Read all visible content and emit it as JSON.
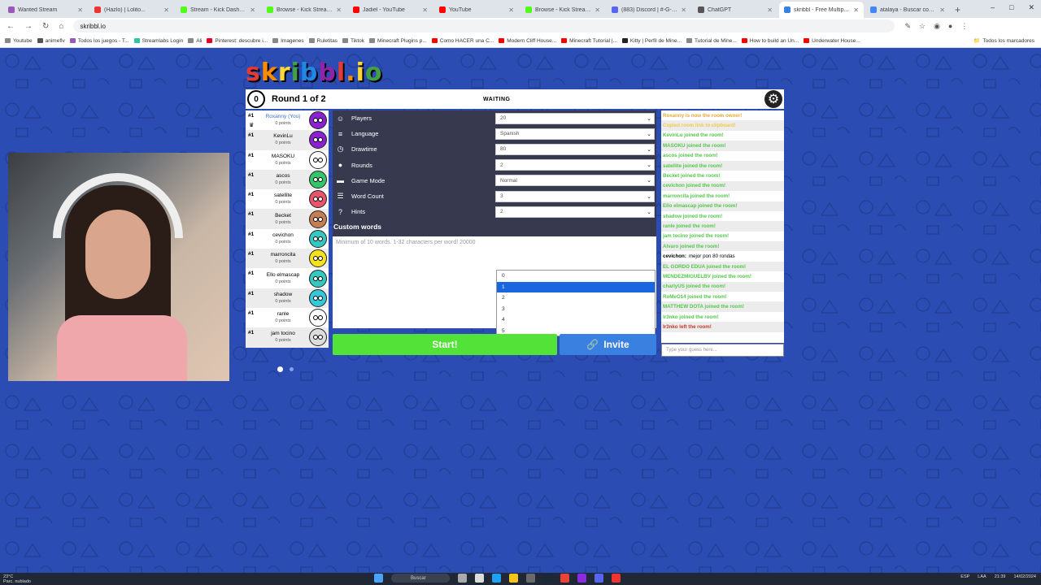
{
  "browser": {
    "tabs": [
      {
        "label": "Wanted Stream",
        "color": "#9b59b6"
      },
      {
        "label": "(Hazlo) | Lolito...",
        "color": "#e33"
      },
      {
        "label": "Stream - Kick Dashboard",
        "color": "#53fc18"
      },
      {
        "label": "Browse - Kick Streaming",
        "color": "#53fc18"
      },
      {
        "label": "Jadiel - YouTube",
        "color": "#f00"
      },
      {
        "label": "YouTube",
        "color": "#f00"
      },
      {
        "label": "Browse - Kick Streaming",
        "color": "#53fc18"
      },
      {
        "label": "(883) Discord | #-G-I-...",
        "color": "#5865f2"
      },
      {
        "label": "ChatGPT",
        "color": "#555"
      },
      {
        "label": "skribbl - Free Multip...",
        "color": "#3a80e0"
      },
      {
        "label": "atalaya - Buscar con Go...",
        "color": "#4285f4"
      }
    ],
    "active_tab": 9,
    "new_tab": "+",
    "window_controls": [
      "–",
      "□",
      "✕"
    ],
    "url": "skribbl.io",
    "bookmarks": [
      {
        "label": "Youtube",
        "color": "#888"
      },
      {
        "label": "animeflv",
        "color": "#555"
      },
      {
        "label": "Todos los juegos - T...",
        "color": "#9b59b6"
      },
      {
        "label": "Streamlabs Login",
        "color": "#31c3a2"
      },
      {
        "label": "Ali",
        "color": "#888"
      },
      {
        "label": "Pinterest: descubre i...",
        "color": "#e60023"
      },
      {
        "label": "Imagenes",
        "color": "#888"
      },
      {
        "label": "Ruletitas",
        "color": "#888"
      },
      {
        "label": "Tiktok",
        "color": "#888"
      },
      {
        "label": "Minecraft Plugins p...",
        "color": "#888"
      },
      {
        "label": "Como HACER una C...",
        "color": "#f00"
      },
      {
        "label": "Modern Cliff House...",
        "color": "#f00"
      },
      {
        "label": "Minecraft Tutorial |...",
        "color": "#f00"
      },
      {
        "label": "Kitty | Perfil de Mine...",
        "color": "#222"
      },
      {
        "label": "Tutorial de Mine...",
        "color": "#888"
      },
      {
        "label": "How to build an Un...",
        "color": "#f00"
      },
      {
        "label": "Underwater House...",
        "color": "#f00"
      }
    ],
    "bookmarks_all": "Todos los marcadores"
  },
  "game": {
    "logo": "skribbl.io",
    "clock": "0",
    "round": "Round 1 of 2",
    "status": "WAITING",
    "players": [
      {
        "rank": "#1",
        "name": "Roxanny (You)",
        "points": "0 points",
        "color": "#8b1fd1",
        "you": true
      },
      {
        "rank": "#1",
        "name": "KevinLu",
        "points": "0 points",
        "color": "#8b1fd1",
        "you": false
      },
      {
        "rank": "#1",
        "name": "MASOKU",
        "points": "0 points",
        "color": "#ffffff",
        "you": false
      },
      {
        "rank": "#1",
        "name": "ascos",
        "points": "0 points",
        "color": "#34c46a",
        "you": false
      },
      {
        "rank": "#1",
        "name": "satellite",
        "points": "0 points",
        "color": "#e9546b",
        "you": false
      },
      {
        "rank": "#1",
        "name": "Becket",
        "points": "0 points",
        "color": "#c57d54",
        "you": false
      },
      {
        "rank": "#1",
        "name": "cevichon",
        "points": "0 points",
        "color": "#35c8c0",
        "you": false
      },
      {
        "rank": "#1",
        "name": "marroncita",
        "points": "0 points",
        "color": "#f6e21a",
        "you": false
      },
      {
        "rank": "#1",
        "name": "Ello elmascap",
        "points": "0 points",
        "color": "#35c8c0",
        "you": false
      },
      {
        "rank": "#1",
        "name": "shadow",
        "points": "0 points",
        "color": "#35c8d8",
        "you": false
      },
      {
        "rank": "#1",
        "name": "ranle",
        "points": "0 points",
        "color": "#ffffff",
        "you": false
      },
      {
        "rank": "#1",
        "name": "jam tocino",
        "points": "0 points",
        "color": "#dddddd",
        "you": false
      }
    ],
    "settings": [
      {
        "label": "Players",
        "value": "20",
        "icon": "☺"
      },
      {
        "label": "Language",
        "value": "Spanish",
        "icon": "≡"
      },
      {
        "label": "Drawtime",
        "value": "80",
        "icon": "◷"
      },
      {
        "label": "Rounds",
        "value": "2",
        "icon": "●"
      },
      {
        "label": "Game Mode",
        "value": "Normal",
        "icon": "▬"
      },
      {
        "label": "Word Count",
        "value": "3",
        "icon": "☰"
      },
      {
        "label": "Hints",
        "value": "2",
        "icon": "?"
      }
    ],
    "custom_words_label": "Custom words",
    "custom_words_placeholder": "Minimum of 10 words. 1-32 characters per word! 20000",
    "hints_options": [
      "0",
      "1",
      "2",
      "3",
      "4",
      "5"
    ],
    "hints_highlighted": "1",
    "start_label": "Start!",
    "invite_label": "Invite",
    "chat": [
      {
        "text": "Roxanny is now the room owner!",
        "color": "#e8a83a"
      },
      {
        "text": "Copied room link to clipboard!",
        "color": "#f2c94c"
      },
      {
        "text": "KevinLu joined the room!",
        "color": "#53c84a"
      },
      {
        "text": "MASOKU joined the room!",
        "color": "#53c84a"
      },
      {
        "text": "ascos joined the room!",
        "color": "#53c84a"
      },
      {
        "text": "satellite joined the room!",
        "color": "#53c84a"
      },
      {
        "text": "Becket joined the room!",
        "color": "#53c84a"
      },
      {
        "text": "cevichon joined the room!",
        "color": "#53c84a"
      },
      {
        "text": "marroncita joined the room!",
        "color": "#53c84a"
      },
      {
        "text": "Ello elmascap joined the room!",
        "color": "#53c84a"
      },
      {
        "text": "shadow joined the room!",
        "color": "#53c84a"
      },
      {
        "text": "ranle joined the room!",
        "color": "#53c84a"
      },
      {
        "text": "jam tocino joined the room!",
        "color": "#53c84a"
      },
      {
        "text": "Alvaro joined the room!",
        "color": "#53c84a"
      },
      {
        "sender": "cevichon:",
        "text": "mejor pon 80 rondas",
        "color": "#000000"
      },
      {
        "text": "EL GORDO EDUA joined the room!",
        "color": "#53c84a"
      },
      {
        "text": "MENDEZMIGUELBV joined the room!",
        "color": "#53c84a"
      },
      {
        "text": "charlyUS joined the room!",
        "color": "#53c84a"
      },
      {
        "text": "RoMeO14 joined the room!",
        "color": "#53c84a"
      },
      {
        "text": "MATTHEW DOTA joined the room!",
        "color": "#53c84a"
      },
      {
        "text": "Ir3nko joined the room!",
        "color": "#53c84a"
      },
      {
        "text": "Ir3nko left the room!",
        "color": "#c0392b"
      }
    ],
    "guess_placeholder": "Type your guess here..."
  },
  "taskbar": {
    "weather_temp": "23°C",
    "weather_text": "Parc. nublado",
    "search": "Buscar",
    "lang": "ESP",
    "lang2": "LAA",
    "time": "21:39",
    "date": "14/02/2024"
  }
}
